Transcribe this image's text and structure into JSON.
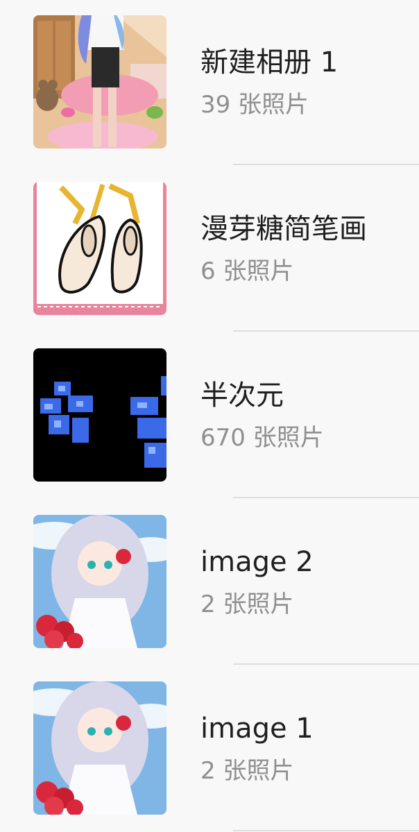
{
  "albums": [
    {
      "title": "新建相册 1",
      "count": "39 张照片",
      "thumbnail": "anime-girl-bedroom"
    },
    {
      "title": "漫芽糖简笔画",
      "count": "6 张照片",
      "thumbnail": "ballet-shoes-drawing"
    },
    {
      "title": "半次元",
      "count": "670 张照片",
      "thumbnail": "blue-pixel-flowers"
    },
    {
      "title": "image 2",
      "count": "2 张照片",
      "thumbnail": "anime-bride-roses"
    },
    {
      "title": "image 1",
      "count": "2 张照片",
      "thumbnail": "anime-bride-roses"
    }
  ]
}
